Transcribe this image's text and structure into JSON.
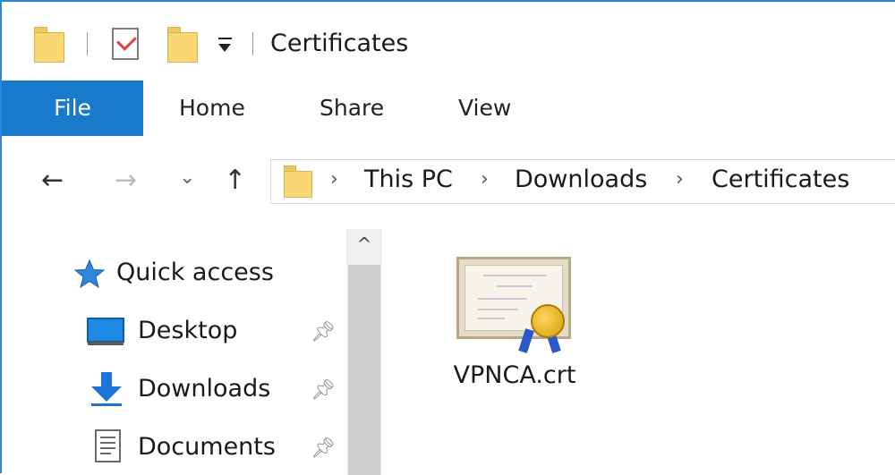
{
  "window": {
    "title": "Certificates"
  },
  "quick_access_toolbar": {
    "icons": [
      "folder-icon",
      "properties-icon",
      "new-folder-icon",
      "customize-dropdown-icon"
    ]
  },
  "ribbon": {
    "tabs": [
      {
        "label": "File",
        "active": true
      },
      {
        "label": "Home"
      },
      {
        "label": "Share"
      },
      {
        "label": "View"
      }
    ]
  },
  "navigation": {
    "back": "←",
    "forward": "→",
    "recent": "⌄",
    "up": "↑"
  },
  "address_bar": {
    "crumbs": [
      "This PC",
      "Downloads",
      "Certificates"
    ],
    "separator": "›"
  },
  "nav_pane": {
    "items": [
      {
        "label": "Quick access",
        "icon": "star-icon"
      },
      {
        "label": "Desktop",
        "icon": "desktop-icon",
        "pinned": true
      },
      {
        "label": "Downloads",
        "icon": "download-arrow-icon",
        "pinned": true
      },
      {
        "label": "Documents",
        "icon": "document-icon",
        "pinned": true
      }
    ],
    "scroll_up": "^"
  },
  "files": [
    {
      "name": "VPNCA.crt",
      "icon": "certificate-icon"
    }
  ],
  "colors": {
    "accent": "#1979ca",
    "folder": "#f8d774",
    "window_border": "#2b87d3"
  }
}
